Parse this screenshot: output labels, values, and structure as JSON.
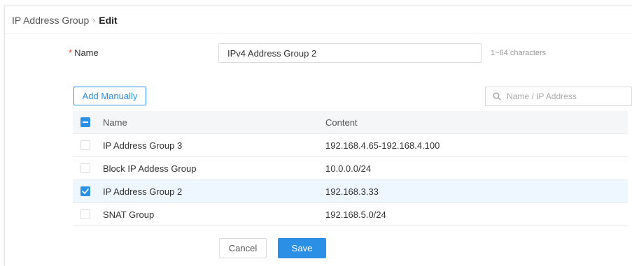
{
  "breadcrumb": {
    "parent": "IP Address Group",
    "separator": "›",
    "current": "Edit"
  },
  "form": {
    "name_label": "Name",
    "required_mark": "*",
    "name_value": "IPv4 Address Group 2",
    "name_hint": "1~64 characters"
  },
  "toolbar": {
    "add_label": "Add Manually",
    "search_placeholder": "Name / IP Address"
  },
  "table": {
    "columns": [
      "Name",
      "Content"
    ],
    "header_checkbox": "indeterminate",
    "rows": [
      {
        "name": "IP Address Group 3",
        "content": "192.168.4.65-192.168.4.100",
        "checked": false
      },
      {
        "name": "Block IP Addess Group",
        "content": "10.0.0.0/24",
        "checked": false
      },
      {
        "name": "IP Address Group 2",
        "content": "192.168.3.33",
        "checked": true
      },
      {
        "name": "SNAT Group",
        "content": "192.168.5.0/24",
        "checked": false
      }
    ]
  },
  "actions": {
    "cancel_label": "Cancel",
    "save_label": "Save"
  },
  "colors": {
    "accent": "#2c8fe6",
    "required": "#e84c3d",
    "selected_row": "#eef6ff",
    "header_row": "#f5f6f8"
  },
  "icons": {
    "search": "search-icon",
    "check": "check-icon",
    "indeterminate": "minus-icon"
  }
}
